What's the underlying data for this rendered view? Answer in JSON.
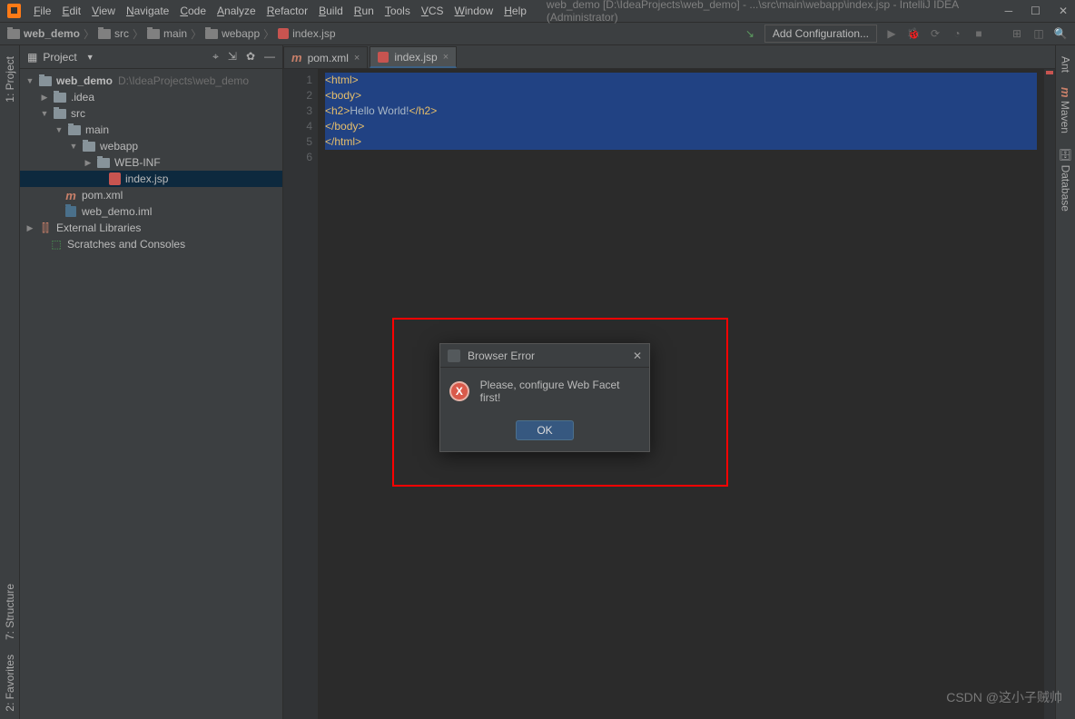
{
  "title_bar": {
    "project": "web_demo",
    "path": "[D:\\IdeaProjects\\web_demo] - ...\\src\\main\\webapp\\index.jsp - IntelliJ IDEA (Administrator)"
  },
  "menu": [
    "File",
    "Edit",
    "View",
    "Navigate",
    "Code",
    "Analyze",
    "Refactor",
    "Build",
    "Run",
    "Tools",
    "VCS",
    "Window",
    "Help"
  ],
  "breadcrumb": [
    "web_demo",
    "src",
    "main",
    "webapp",
    "index.jsp"
  ],
  "nav": {
    "add_config": "Add Configuration..."
  },
  "panel": {
    "title": "Project"
  },
  "tree": {
    "root": "web_demo",
    "root_path": "D:\\IdeaProjects\\web_demo",
    "idea": ".idea",
    "src": "src",
    "main": "main",
    "webapp": "webapp",
    "webinf": "WEB-INF",
    "index": "index.jsp",
    "pom": "pom.xml",
    "iml": "web_demo.iml",
    "ext": "External Libraries",
    "scratch": "Scratches and Consoles"
  },
  "editor_tabs": {
    "pom": "pom.xml",
    "index": "index.jsp"
  },
  "code_lines": {
    "l1": "<html>",
    "l2": "<body>",
    "l3_open": "<h2>",
    "l3_text": "Hello World!",
    "l3_close": "</h2>",
    "l4": "</body>",
    "l5": "</html>"
  },
  "gutter": [
    "1",
    "2",
    "3",
    "4",
    "5",
    "6"
  ],
  "dialog": {
    "title": "Browser Error",
    "message": "Please, configure Web Facet first!",
    "ok": "OK"
  },
  "sidebars": {
    "left_project": "1: Project",
    "left_structure": "7: Structure",
    "left_favorites": "2: Favorites",
    "right_ant": "Ant",
    "right_maven": "Maven",
    "right_database": "Database"
  },
  "watermark": "CSDN @这小子贼帅"
}
